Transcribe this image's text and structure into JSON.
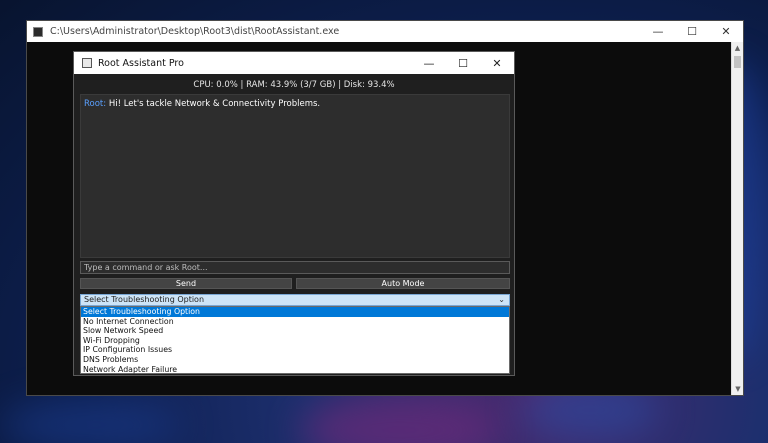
{
  "console": {
    "title": "C:\\Users\\Administrator\\Desktop\\Root3\\dist\\RootAssistant.exe",
    "minimize": "—",
    "maximize": "☐",
    "close": "✕"
  },
  "app": {
    "title": "Root Assistant Pro",
    "minimize": "—",
    "maximize": "☐",
    "close": "✕",
    "stats": "CPU: 0.0% | RAM: 43.9% (3/7 GB) | Disk: 93.4%",
    "chat": {
      "sender": "Root:",
      "message": " Hi! Let's tackle Network & Connectivity Problems."
    },
    "input": {
      "placeholder": "Type a command or ask Root..."
    },
    "send_label": "Send",
    "auto_label": "Auto Mode",
    "select": {
      "value": "Select Troubleshooting Option",
      "options": [
        "Select Troubleshooting Option",
        "No Internet Connection",
        "Slow Network Speed",
        "Wi-Fi Dropping",
        "IP Configuration Issues",
        "DNS Problems",
        "Network Adapter Failure"
      ]
    }
  },
  "colors": {
    "accent": "#0078d7",
    "sender": "#5aa0ff",
    "background": "#1f1f1f"
  }
}
